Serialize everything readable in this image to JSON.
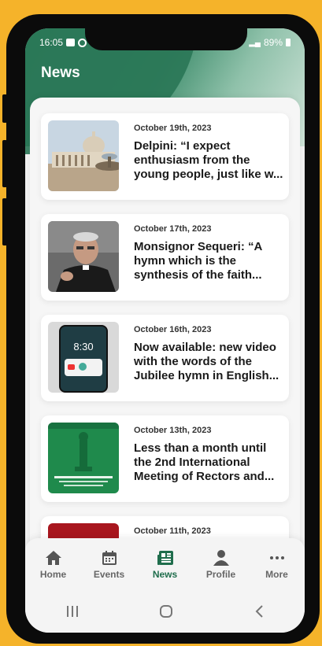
{
  "status": {
    "time": "16:05",
    "battery": "89%"
  },
  "header": {
    "title": "News"
  },
  "news": [
    {
      "date": "October 19th, 2023",
      "headline": "Delpini: “I expect enthusiasm from the young people, just like w..."
    },
    {
      "date": "October 17th, 2023",
      "headline": "Monsignor Sequeri: “A hymn which is the synthesis of the faith..."
    },
    {
      "date": "October 16th, 2023",
      "headline": "Now available: new video with the words of the Jubilee hymn in English..."
    },
    {
      "date": "October 13th, 2023",
      "headline": "Less than a month until the 2nd International Meeting of Rectors and..."
    },
    {
      "date": "October 11th, 2023",
      "headline": ""
    }
  ],
  "thumb3": {
    "clock": "8:30"
  },
  "nav": {
    "home": "Home",
    "events": "Events",
    "news": "News",
    "profile": "Profile",
    "more": "More"
  },
  "colors": {
    "accent": "#1f6d4c",
    "background": "#f5b32a"
  }
}
